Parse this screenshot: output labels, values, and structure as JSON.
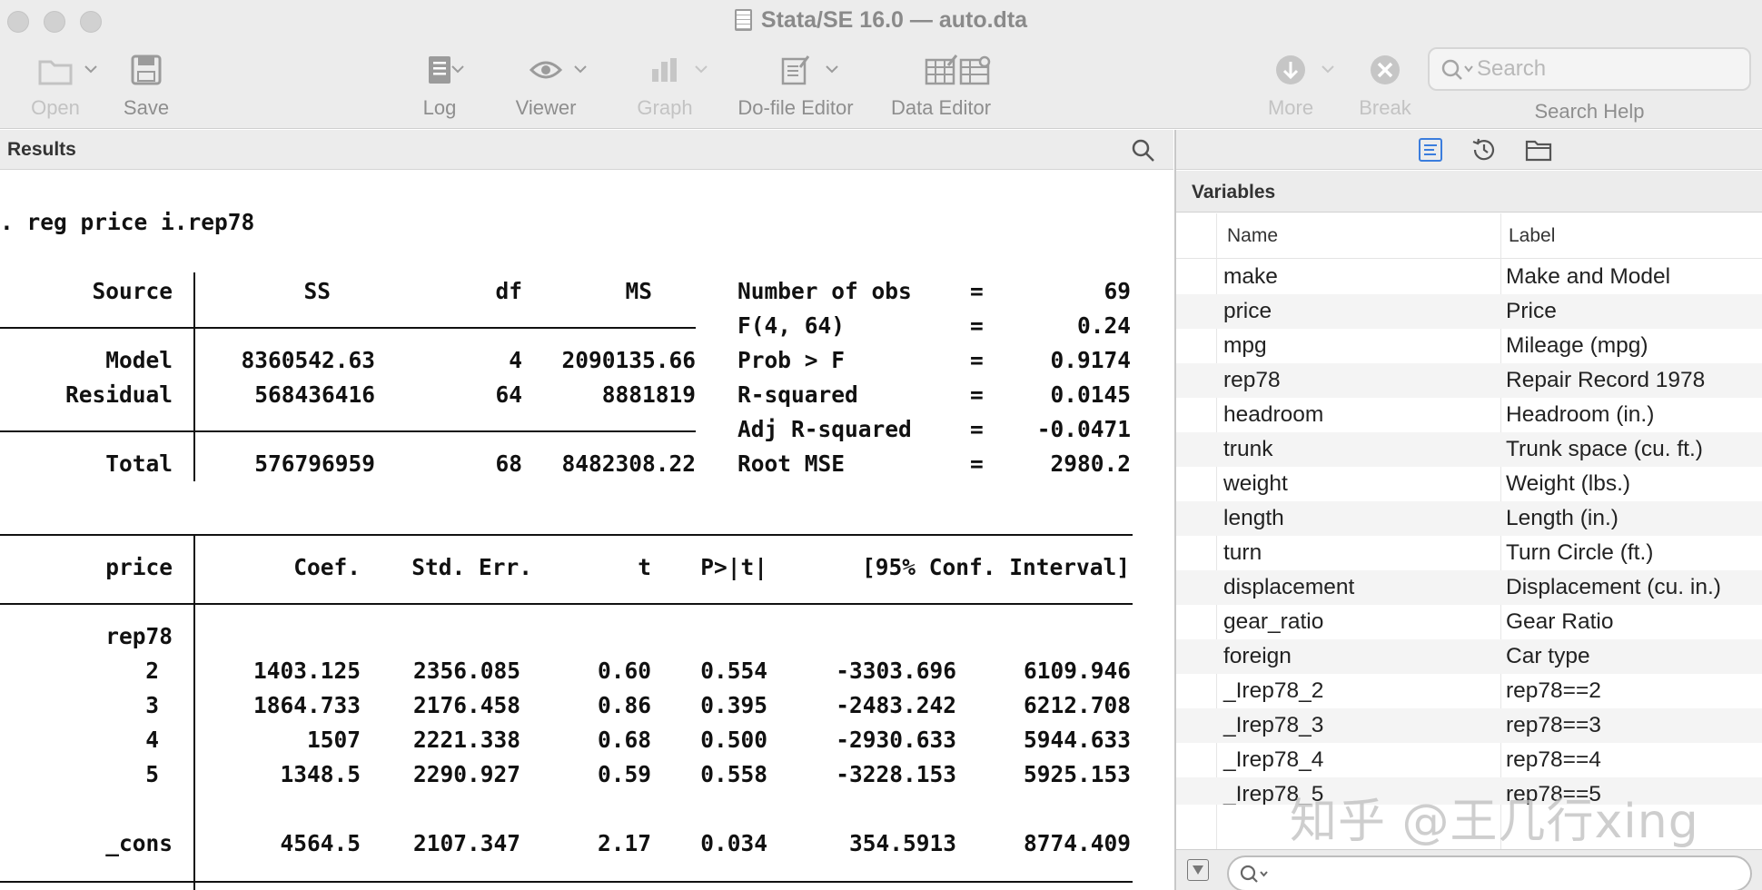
{
  "window": {
    "title": "Stata/SE 16.0 — auto.dta"
  },
  "toolbar": {
    "open": "Open",
    "save": "Save",
    "log": "Log",
    "viewer": "Viewer",
    "graph": "Graph",
    "do_file_editor": "Do-file Editor",
    "data_editor": "Data Editor",
    "more": "More",
    "break": "Break",
    "search_placeholder": "Search",
    "search_help": "Search Help"
  },
  "results": {
    "title": "Results",
    "command": ". reg price i.rep78",
    "anova": {
      "headers": {
        "source": "Source",
        "ss": "SS",
        "df": "df",
        "ms": "MS"
      },
      "rows": [
        {
          "source": "Model",
          "ss": "8360542.63",
          "df": "4",
          "ms": "2090135.66"
        },
        {
          "source": "Residual",
          "ss": "568436416",
          "df": "64",
          "ms": "8881819"
        },
        {
          "source": "Total",
          "ss": "576796959",
          "df": "68",
          "ms": "8482308.22"
        }
      ]
    },
    "stats": [
      {
        "label": "Number of obs",
        "eq": "=",
        "value": "69"
      },
      {
        "label": "F(4, 64)",
        "eq": "=",
        "value": "0.24"
      },
      {
        "label": "Prob > F",
        "eq": "=",
        "value": "0.9174"
      },
      {
        "label": "R-squared",
        "eq": "=",
        "value": "0.0145"
      },
      {
        "label": "Adj R-squared",
        "eq": "=",
        "value": "-0.0471"
      },
      {
        "label": "Root MSE",
        "eq": "=",
        "value": "2980.2"
      }
    ],
    "coef": {
      "headers": {
        "var": "price",
        "coef": "Coef.",
        "se": "Std. Err.",
        "t": "t",
        "p": "P>|t|",
        "ci": "[95% Conf. Interval]"
      },
      "group": "rep78",
      "rows": [
        {
          "var": "2",
          "coef": "1403.125",
          "se": "2356.085",
          "t": "0.60",
          "p": "0.554",
          "lo": "-3303.696",
          "hi": "6109.946"
        },
        {
          "var": "3",
          "coef": "1864.733",
          "se": "2176.458",
          "t": "0.86",
          "p": "0.395",
          "lo": "-2483.242",
          "hi": "6212.708"
        },
        {
          "var": "4",
          "coef": "1507",
          "se": "2221.338",
          "t": "0.68",
          "p": "0.500",
          "lo": "-2930.633",
          "hi": "5944.633"
        },
        {
          "var": "5",
          "coef": "1348.5",
          "se": "2290.927",
          "t": "0.59",
          "p": "0.558",
          "lo": "-3228.153",
          "hi": "5925.153"
        },
        {
          "var": "_cons",
          "coef": "4564.5",
          "se": "2107.347",
          "t": "2.17",
          "p": "0.034",
          "lo": "354.5913",
          "hi": "8774.409"
        }
      ]
    }
  },
  "variables": {
    "title": "Variables",
    "col_name": "Name",
    "col_label": "Label",
    "items": [
      {
        "name": "make",
        "label": "Make and Model"
      },
      {
        "name": "price",
        "label": "Price"
      },
      {
        "name": "mpg",
        "label": "Mileage (mpg)"
      },
      {
        "name": "rep78",
        "label": "Repair Record 1978"
      },
      {
        "name": "headroom",
        "label": "Headroom (in.)"
      },
      {
        "name": "trunk",
        "label": "Trunk space (cu. ft.)"
      },
      {
        "name": "weight",
        "label": "Weight (lbs.)"
      },
      {
        "name": "length",
        "label": "Length (in.)"
      },
      {
        "name": "turn",
        "label": "Turn Circle (ft.)"
      },
      {
        "name": "displacement",
        "label": "Displacement (cu. in.)"
      },
      {
        "name": "gear_ratio",
        "label": "Gear Ratio"
      },
      {
        "name": "foreign",
        "label": "Car type"
      },
      {
        "name": "_Irep78_2",
        "label": "rep78==2"
      },
      {
        "name": "_Irep78_3",
        "label": "rep78==3"
      },
      {
        "name": "_Irep78_4",
        "label": "rep78==4"
      },
      {
        "name": "_Irep78_5",
        "label": "rep78==5"
      }
    ]
  },
  "watermark": "知乎 @王几行xing",
  "colors": {
    "accent": "#3b7ddd",
    "toolbar_bg": "#ececec",
    "row_alt": "#f4f4f4"
  }
}
